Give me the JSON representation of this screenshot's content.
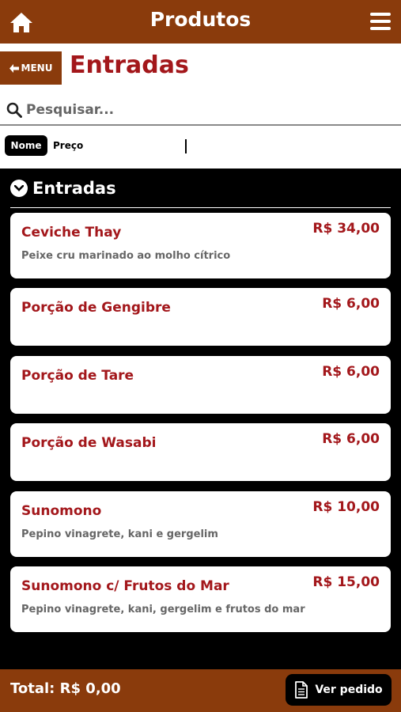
{
  "header": {
    "title": "Produtos",
    "home_icon": "home-icon",
    "menu_icon": "hamburger-icon"
  },
  "nav": {
    "menu_label": "MENU",
    "back_icon": "arrow-left-icon",
    "section_title": "Entradas"
  },
  "search": {
    "placeholder": "Pesquisar...",
    "value": "",
    "icon": "search-icon"
  },
  "sort": {
    "options": [
      "Nome",
      "Preço"
    ],
    "active": "Nome"
  },
  "group": {
    "title": "Entradas",
    "icon": "chevron-down-circle-icon"
  },
  "products": [
    {
      "name": "Ceviche Thay",
      "price": "R$ 34,00",
      "description": "Peixe cru marinado ao molho cítrico"
    },
    {
      "name": "Porção de Gengibre",
      "price": "R$ 6,00",
      "description": ""
    },
    {
      "name": "Porção de Tare",
      "price": "R$ 6,00",
      "description": ""
    },
    {
      "name": "Porção de Wasabi",
      "price": "R$ 6,00",
      "description": ""
    },
    {
      "name": "Sunomono",
      "price": "R$ 10,00",
      "description": "Pepino vinagrete, kani e gergelim"
    },
    {
      "name": "Sunomono c/ Frutos do Mar",
      "price": "R$ 15,00",
      "description": "Pepino vinagrete, kani, gergelim e frutos do mar"
    }
  ],
  "footer": {
    "total": "Total: R$ 0,00",
    "order_label": "Ver pedido",
    "order_icon": "document-icon"
  },
  "colors": {
    "brand": "#8a3b0c",
    "accent": "#a3171b",
    "background": "#000000"
  }
}
